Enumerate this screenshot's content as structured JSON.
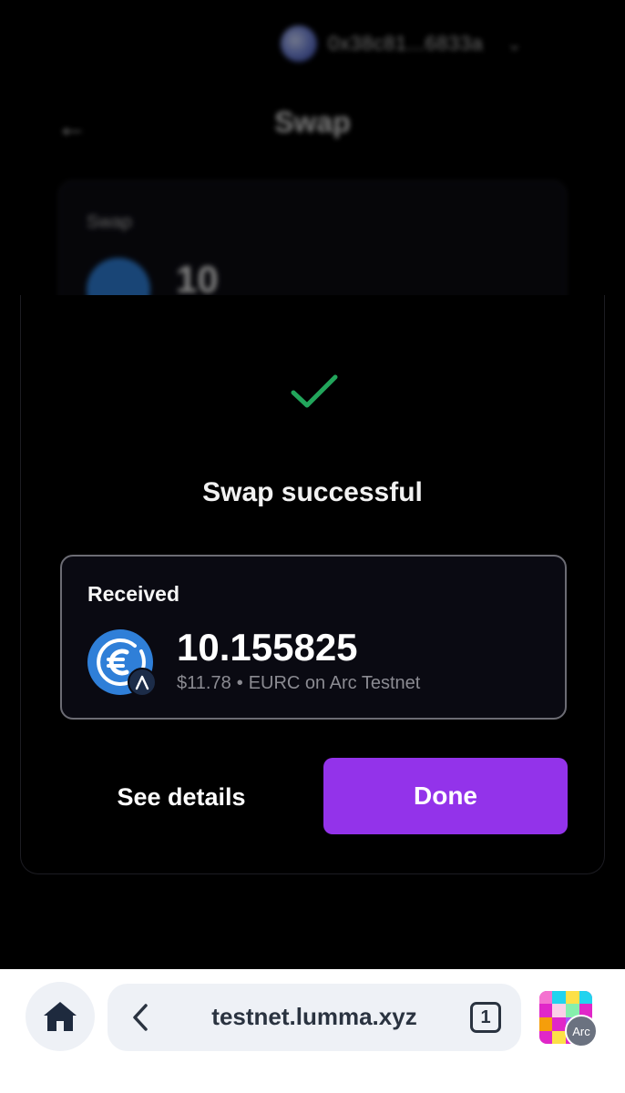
{
  "background": {
    "wallet_address": "0x38c81...6833a",
    "title": "Swap",
    "card_label": "Swap",
    "amount": "10"
  },
  "modal": {
    "status_icon": "check-icon",
    "title": "Swap successful",
    "received": {
      "label": "Received",
      "amount": "10.155825",
      "usd_value": "$11.78",
      "separator": "•",
      "token_network": "EURC on Arc Testnet",
      "token_icon": "euro-coin-icon",
      "network_badge_icon": "arc-logo-icon"
    },
    "see_details_label": "See details",
    "done_label": "Done"
  },
  "browser": {
    "url": "testnet.lumma.xyz",
    "tab_count": "1",
    "app_badge": "Arc"
  },
  "colors": {
    "accent": "#9333ea",
    "success": "#22a55b",
    "token_blue": "#2f7fd8"
  }
}
